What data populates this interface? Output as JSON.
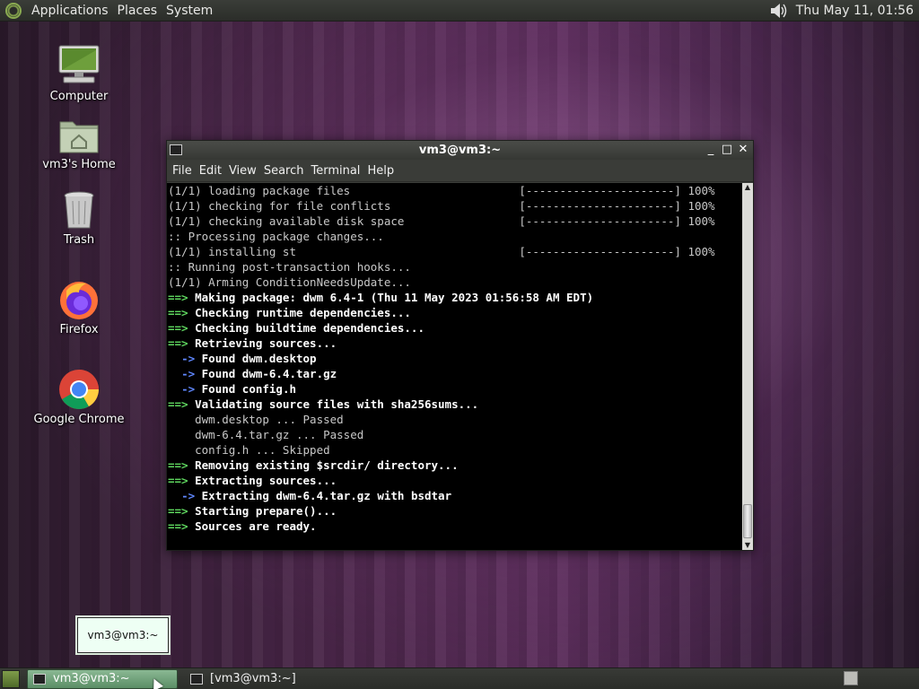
{
  "top_panel": {
    "menus": [
      "Applications",
      "Places",
      "System"
    ],
    "clock": "Thu May 11, 01:56",
    "icons": {
      "logo": "distro-logo-icon",
      "volume": "volume-icon"
    }
  },
  "desktop": {
    "icons": [
      {
        "label": "Computer",
        "icon": "computer-icon"
      },
      {
        "label": "vm3's Home",
        "icon": "home-folder-icon"
      },
      {
        "label": "Trash",
        "icon": "trash-icon"
      },
      {
        "label": "Firefox",
        "icon": "firefox-icon"
      },
      {
        "label": "Google Chrome",
        "icon": "chrome-icon"
      }
    ]
  },
  "terminal": {
    "title": "vm3@vm3:~",
    "menus": [
      "File",
      "Edit",
      "View",
      "Search",
      "Terminal",
      "Help"
    ],
    "buttons": {
      "minimize": "_",
      "maximize": "□",
      "close": "✕"
    },
    "lines": [
      "(1/1) loading package files                         [----------------------] 100%",
      "(1/1) checking for file conflicts                   [----------------------] 100%",
      "(1/1) checking available disk space                 [----------------------] 100%",
      ":: Processing package changes...",
      "(1/1) installing st                                 [----------------------] 100%",
      ":: Running post-transaction hooks...",
      "(1/1) Arming ConditionNeedsUpdate...",
      "==> Making package: dwm 6.4-1 (Thu 11 May 2023 01:56:58 AM EDT)",
      "==> Checking runtime dependencies...",
      "==> Checking buildtime dependencies...",
      "==> Retrieving sources...",
      "  -> Found dwm.desktop",
      "  -> Found dwm-6.4.tar.gz",
      "  -> Found config.h",
      "==> Validating source files with sha256sums...",
      "    dwm.desktop ... Passed",
      "    dwm-6.4.tar.gz ... Passed",
      "    config.h ... Skipped",
      "==> Removing existing $srcdir/ directory...",
      "==> Extracting sources...",
      "  -> Extracting dwm-6.4.tar.gz with bsdtar",
      "==> Starting prepare()...",
      "==> Sources are ready."
    ]
  },
  "tooltip": {
    "text": "vm3@vm3:~"
  },
  "taskbar": {
    "tasks": [
      {
        "label": "vm3@vm3:~",
        "active": true
      },
      {
        "label": "[vm3@vm3:~]",
        "active": false
      }
    ]
  }
}
